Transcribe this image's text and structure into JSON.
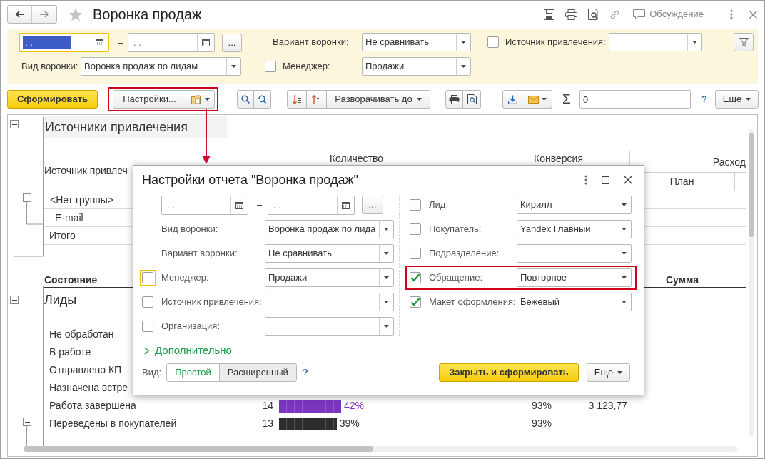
{
  "window": {
    "title": "Воронка продаж",
    "discussion": "Обсуждение"
  },
  "filter_panel": {
    "date_from": {
      "value": ". .",
      "focused": true
    },
    "separator": "–",
    "date_to": {
      "value": ". .",
      "focused": false
    },
    "period_button": "...",
    "funnel_type": {
      "label": "Вид воронки:",
      "value": "Воронка продаж по лидам"
    },
    "funnel_variant": {
      "label": "Вариант воронки:",
      "value": "Не сравнивать"
    },
    "manager": {
      "label": "Менеджер:",
      "value": "Продажи",
      "checked": false
    },
    "source": {
      "label": "Источник привлечения:",
      "checked": false
    }
  },
  "toolbar": {
    "generate": "Сформировать",
    "settings": "Настройки...",
    "settings_highlighted": true,
    "expand": "Разворачивать до",
    "sum_sign": "Σ",
    "sum_value": "0",
    "help": "?",
    "more": "Еще"
  },
  "report": {
    "section_title": "Источники привлечения",
    "header": {
      "source": "Источник привлеч",
      "quantity": "Количество",
      "conversion": "Конверсия",
      "expense": "Расход",
      "plan": "План"
    },
    "source_rows": [
      {
        "kind": "group",
        "label": "<Нет группы>"
      },
      {
        "kind": "item",
        "label": "E-mail"
      },
      {
        "kind": "total",
        "label": "Итого"
      }
    ],
    "state_header": "Состояние",
    "sum_header": "Сумма",
    "group_title": "Лиды",
    "state_rows": [
      {
        "label": "Не обработан"
      },
      {
        "label": "В работе"
      },
      {
        "label": "Отправлено КП"
      },
      {
        "label": "Назначена встре"
      },
      {
        "label": "Работа завершена",
        "count": "14",
        "level": 0.42,
        "color": "#7b35c0",
        "percent": "42%",
        "conversion": "93%",
        "sum": "3 123,77"
      },
      {
        "label": "Переведены в покупателей",
        "count": "13",
        "level": 0.39,
        "color": "#2d2d2d",
        "percent": "39%",
        "conversion": "93%"
      }
    ]
  },
  "dialog": {
    "title": "Настройки отчета \"Воронка продаж\"",
    "date_from": ". .",
    "separator": "–",
    "date_to": ". .",
    "period_button": "...",
    "left_fields": [
      {
        "kind": "plain",
        "label": "Вид воронки:",
        "value": "Воронка продаж по лида"
      },
      {
        "kind": "plain",
        "label": "Вариант воронки:",
        "value": "Не сравнивать"
      },
      {
        "kind": "toggle",
        "label": "Менеджер:",
        "value": "Продажи",
        "checked": false,
        "focused": true
      },
      {
        "kind": "toggle",
        "label": "Источник привлечения:",
        "checked": false,
        "focused": false
      },
      {
        "kind": "toggle",
        "label": "Организация:",
        "checked": false,
        "focused": false
      }
    ],
    "right_fields": [
      {
        "label": "Лид:",
        "value": "Кирилл",
        "checked": false,
        "highlighted": false
      },
      {
        "label": "Покупатель:",
        "value": "Yandex Главный",
        "checked": false,
        "highlighted": false
      },
      {
        "label": "Подразделение:",
        "checked": false,
        "highlighted": false
      },
      {
        "label": "Обращение:",
        "value": "Повторное",
        "checked": true,
        "highlighted": true
      },
      {
        "label": "Макет оформления:",
        "value": "Бежевый",
        "checked": true,
        "highlighted": false
      }
    ],
    "more_section": "Дополнительно",
    "view_label": "Вид:",
    "view_options": [
      {
        "label": "Простой",
        "selected": true
      },
      {
        "label": "Расширенный",
        "selected": false
      }
    ],
    "help": "?",
    "primary_button": "Закрыть и сформировать",
    "more_button": "Еще"
  }
}
